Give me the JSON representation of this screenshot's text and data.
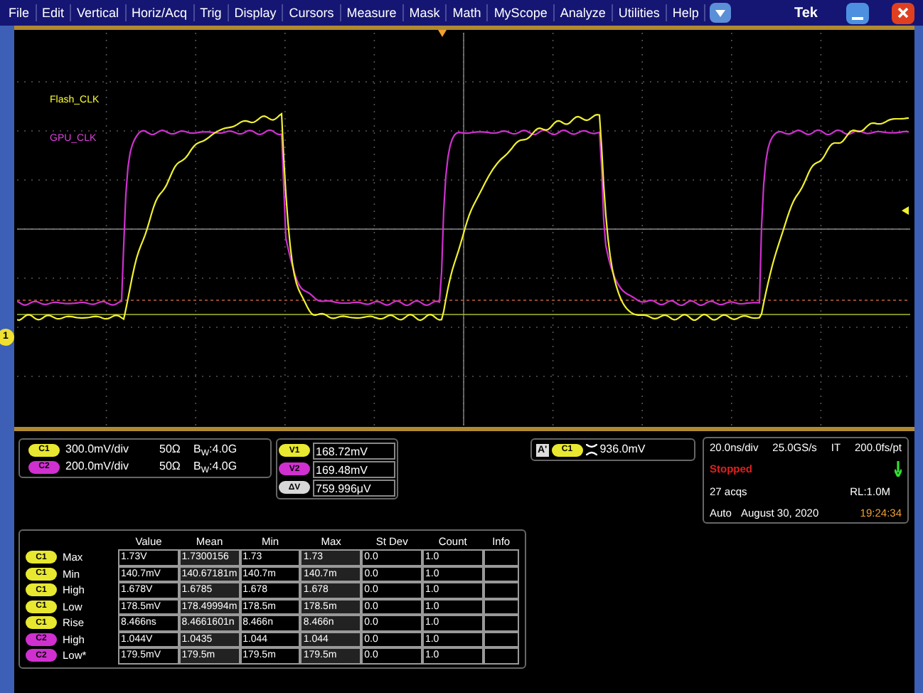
{
  "menu": [
    {
      "label": "File"
    },
    {
      "label": "Edit"
    },
    {
      "label": "Vertical"
    },
    {
      "label": "Horiz/Acq"
    },
    {
      "label": "Trig"
    },
    {
      "label": "Display"
    },
    {
      "label": "Cursors"
    },
    {
      "label": "Measure"
    },
    {
      "label": "Mask"
    },
    {
      "label": "Math"
    },
    {
      "label": "MyScope"
    },
    {
      "label": "Analyze"
    },
    {
      "label": "Utilities"
    },
    {
      "label": "Help"
    }
  ],
  "brand": "Tek",
  "trace_labels": [
    {
      "label": "Flash_CLK",
      "color": "#ffff33"
    },
    {
      "label": "GPU_CLK",
      "color": "#e040e0"
    }
  ],
  "ground_marker": "1",
  "channels": [
    {
      "badge": "C1",
      "color": "#e8e830",
      "scale": "300.0mV/div",
      "impedance": "50Ω",
      "bandwidth": "B$_{W}$:4.0G"
    },
    {
      "badge": "C2",
      "color": "#d030d0",
      "scale": "200.0mV/div",
      "impedance": "50Ω",
      "bandwidth": "B$_{W}$:4.0G"
    }
  ],
  "cursors": [
    {
      "badge": "V1",
      "color": "#e8e830",
      "value": "168.72mV"
    },
    {
      "badge": "V2",
      "color": "#d030d0",
      "value": "169.48mV"
    },
    {
      "badge": "ΔV",
      "color": "#d8d8d8",
      "value": "759.996μV"
    }
  ],
  "trigger": {
    "label": "A'",
    "badge": "C1",
    "color": "#e8e830",
    "value": "936.0mV"
  },
  "timebase": {
    "scale": "20.0ns/div",
    "rate": "25.0GS/s",
    "mode": "IT",
    "resolution": "200.0fs/pt",
    "status": "Stopped",
    "acqs": "27 acqs",
    "record_length": "RL:1.0M",
    "trigger_mode": "Auto",
    "date": "August 30, 2020",
    "time": "19:24:34"
  },
  "measurements": {
    "columns": [
      "Value",
      "Mean",
      "Min",
      "Max",
      "St Dev",
      "Count",
      "Info"
    ],
    "rows": [
      {
        "badge": "C1",
        "color": "#e8e830",
        "name": "Max",
        "cells": [
          "1.73V",
          "1.7300156",
          "1.73",
          "1.73",
          "0.0",
          "1.0"
        ]
      },
      {
        "badge": "C1",
        "color": "#e8e830",
        "name": "Min",
        "cells": [
          "140.7mV",
          "140.67181m",
          "140.7m",
          "140.7m",
          "0.0",
          "1.0"
        ]
      },
      {
        "badge": "C1",
        "color": "#e8e830",
        "name": "High",
        "cells": [
          "1.678V",
          "1.6785",
          "1.678",
          "1.678",
          "0.0",
          "1.0"
        ]
      },
      {
        "badge": "C1",
        "color": "#e8e830",
        "name": "Low",
        "cells": [
          "178.5mV",
          "178.49994m",
          "178.5m",
          "178.5m",
          "0.0",
          "1.0"
        ]
      },
      {
        "badge": "C1",
        "color": "#e8e830",
        "name": "Rise",
        "cells": [
          "8.466ns",
          "8.4661601n",
          "8.466n",
          "8.466n",
          "0.0",
          "1.0"
        ]
      },
      {
        "badge": "C2",
        "color": "#d030d0",
        "name": "High",
        "cells": [
          "1.044V",
          "1.0435",
          "1.044",
          "1.044",
          "0.0",
          "1.0"
        ]
      },
      {
        "badge": "C2",
        "color": "#d030d0",
        "name": "Low*",
        "cells": [
          "179.5mV",
          "179.5m",
          "179.5m",
          "179.5m",
          "0.0",
          "1.0"
        ]
      }
    ]
  }
}
